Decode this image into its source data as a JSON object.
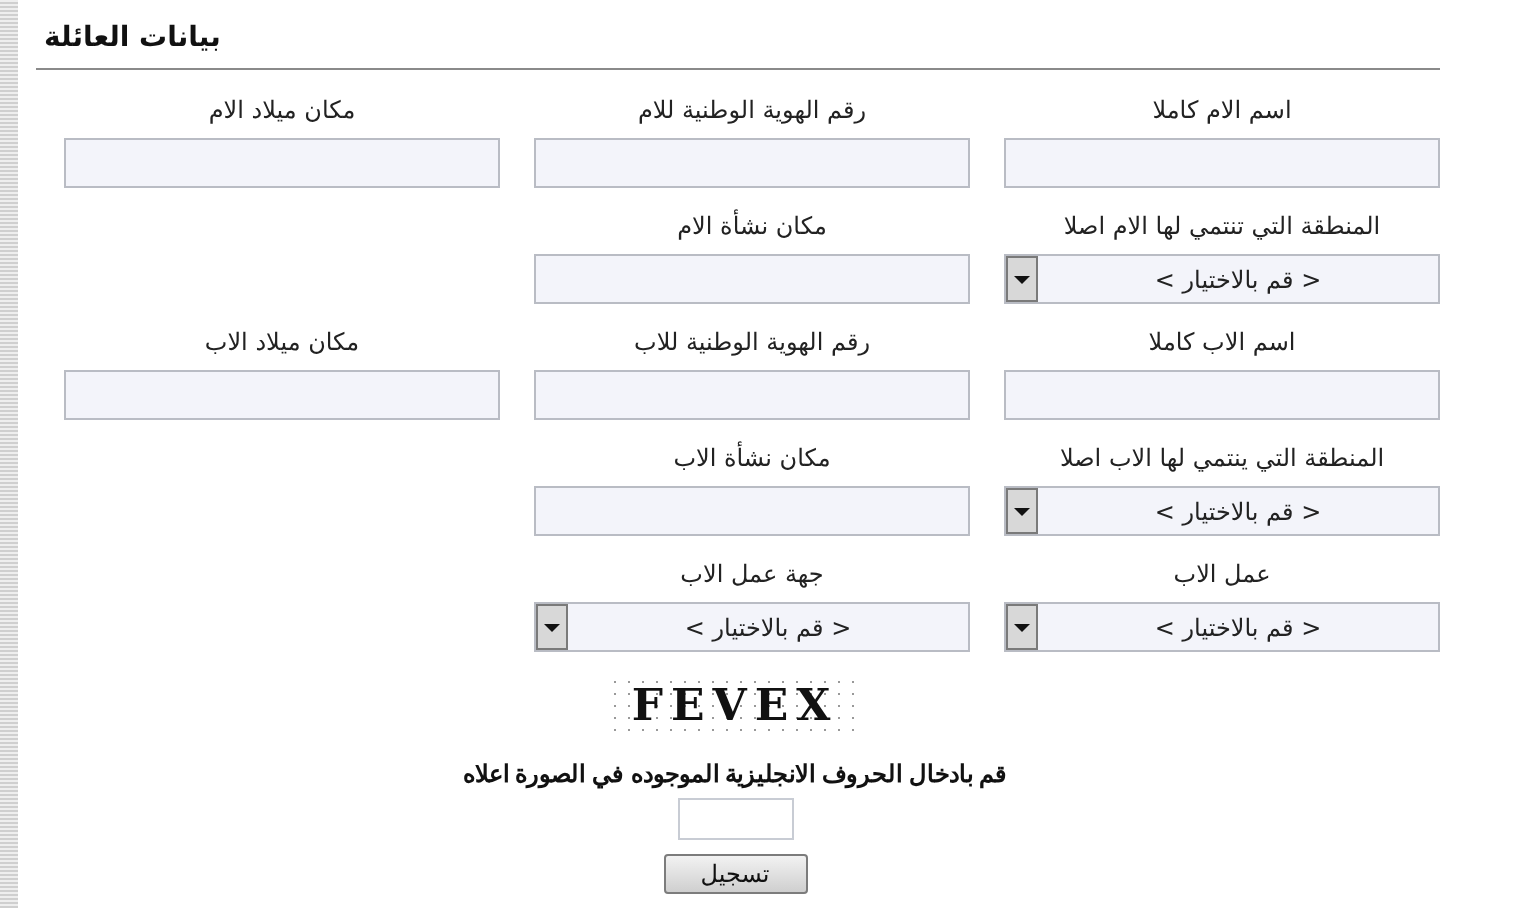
{
  "section": {
    "title": "بيانات العائلة"
  },
  "rows": [
    [
      {
        "kind": "text",
        "label": "اسم الام كاملا"
      },
      {
        "kind": "text",
        "label": "رقم الهوية الوطنية للام"
      },
      {
        "kind": "text",
        "label": "مكان ميلاد الام"
      }
    ],
    [
      {
        "kind": "select",
        "label": "المنطقة التي تنتمي لها الام اصلا",
        "value": "< قم بالاختيار >"
      },
      {
        "kind": "text",
        "label": "مكان نشأة الام"
      },
      {
        "kind": "blank"
      }
    ],
    [
      {
        "kind": "text",
        "label": "اسم الاب كاملا"
      },
      {
        "kind": "text",
        "label": "رقم الهوية الوطنية للاب"
      },
      {
        "kind": "text",
        "label": "مكان ميلاد الاب"
      }
    ],
    [
      {
        "kind": "select",
        "label": "المنطقة التي ينتمي لها الاب اصلا",
        "value": "< قم بالاختيار >"
      },
      {
        "kind": "text",
        "label": "مكان نشأة الاب"
      },
      {
        "kind": "blank"
      }
    ],
    [
      {
        "kind": "select",
        "label": "عمل الاب",
        "value": "< قم بالاختيار >"
      },
      {
        "kind": "select",
        "label": "جهة عمل الاب",
        "value": "< قم بالاختيار >"
      },
      {
        "kind": "blank"
      }
    ]
  ],
  "captcha": {
    "image_text": "FEVEX",
    "instruction": "قم بادخال الحروف الانجليزية الموجوده في الصورة اعلاه"
  },
  "submit_button": "تسجيل"
}
